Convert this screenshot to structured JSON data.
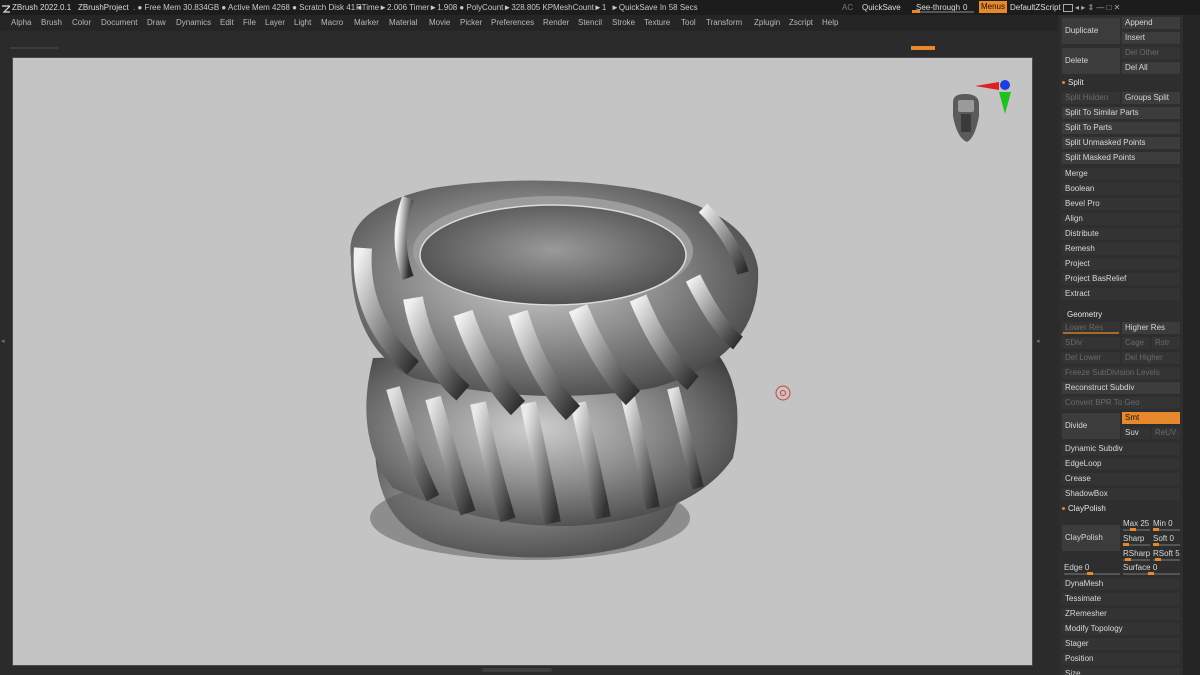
{
  "titlebar": {
    "app": "ZBrush 2022.0.1",
    "project": "ZBrushProject",
    "stats": ". ● Free Mem 30.834GB ● Active Mem 4268 ● Scratch Disk 41 ●",
    "rtime": "RTime►2.006 Timer►1.908 ● PolyCount►328.805 KP",
    "meshcount": "MeshCount►1",
    "quicksave_in": "►QuickSave In 58 Secs",
    "ac": "AC",
    "quicksave": "QuickSave",
    "seethrough": "See-through",
    "seethrough_value": "0",
    "menus": "Menus",
    "defaultzscript": "DefaultZScript"
  },
  "menubar": [
    "Alpha",
    "Brush",
    "Color",
    "Document",
    "Draw",
    "Dynamics",
    "Edit",
    "File",
    "Layer",
    "Light",
    "Macro",
    "Marker",
    "Material",
    "Movie",
    "Picker",
    "Preferences",
    "Render",
    "Stencil",
    "Stroke",
    "Texture",
    "Tool",
    "Transform",
    "Zplugin",
    "Zscript",
    "Help"
  ],
  "subtool": {
    "duplicate": "Duplicate",
    "append": "Append",
    "insert": "Insert",
    "delete": "Delete",
    "del_other": "Del Other",
    "del_all": "Del All",
    "split": "Split",
    "split_hidden": "Split Hidden",
    "groups_split": "Groups Split",
    "split_similar": "Split To Similar Parts",
    "split_parts": "Split To Parts",
    "split_unmasked": "Split Unmasked Points",
    "split_masked": "Split Masked Points",
    "merge": "Merge",
    "boolean": "Boolean",
    "bevel_pro": "Bevel Pro",
    "align": "Align",
    "distribute": "Distribute",
    "remesh": "Remesh",
    "project": "Project",
    "project_basrelief": "Project BasRelief",
    "extract": "Extract"
  },
  "geometry": {
    "title": "Geometry",
    "lower_res": "Lower Res",
    "higher_res": "Higher Res",
    "sdiv": "SDiv",
    "cage": "Cage",
    "rstr": "Rstr",
    "del_lower": "Del Lower",
    "del_higher": "Del Higher",
    "freeze": "Freeze SubDivision Levels",
    "reconstruct": "Reconstruct Subdiv",
    "convert_bpr": "Convert BPR To Geo",
    "divide": "Divide",
    "smt": "Smt",
    "suv": "Suv",
    "reuv": "ReUV",
    "dynamic_subdiv": "Dynamic Subdiv",
    "edgeloop": "EdgeLoop",
    "crease": "Crease",
    "shadowbox": "ShadowBox",
    "claypolish_hdr": "ClayPolish",
    "claypolish": "ClayPolish",
    "max_label": "Max",
    "max_value": "25",
    "min_label": "Min",
    "min_value": "0",
    "sharp_label": "Sharp",
    "soft_label": "Soft",
    "soft_value": "0",
    "rsharp_label": "RSharp",
    "rsoft_label": "RSoft",
    "rsoft_value": "5",
    "edge_label": "Edge",
    "edge_value": "0",
    "surface_label": "Surface",
    "surface_value": "0",
    "dynamesh": "DynaMesh",
    "tessimate": "Tessimate",
    "zremesher": "ZRemesher",
    "modify_topology": "Modify Topology",
    "stager": "Stager",
    "position": "Position",
    "size": "Size"
  },
  "colors": {
    "accent": "#e8882c",
    "viewport_bg": "#c4c4c4",
    "panel_bg": "#2e2e2e"
  }
}
